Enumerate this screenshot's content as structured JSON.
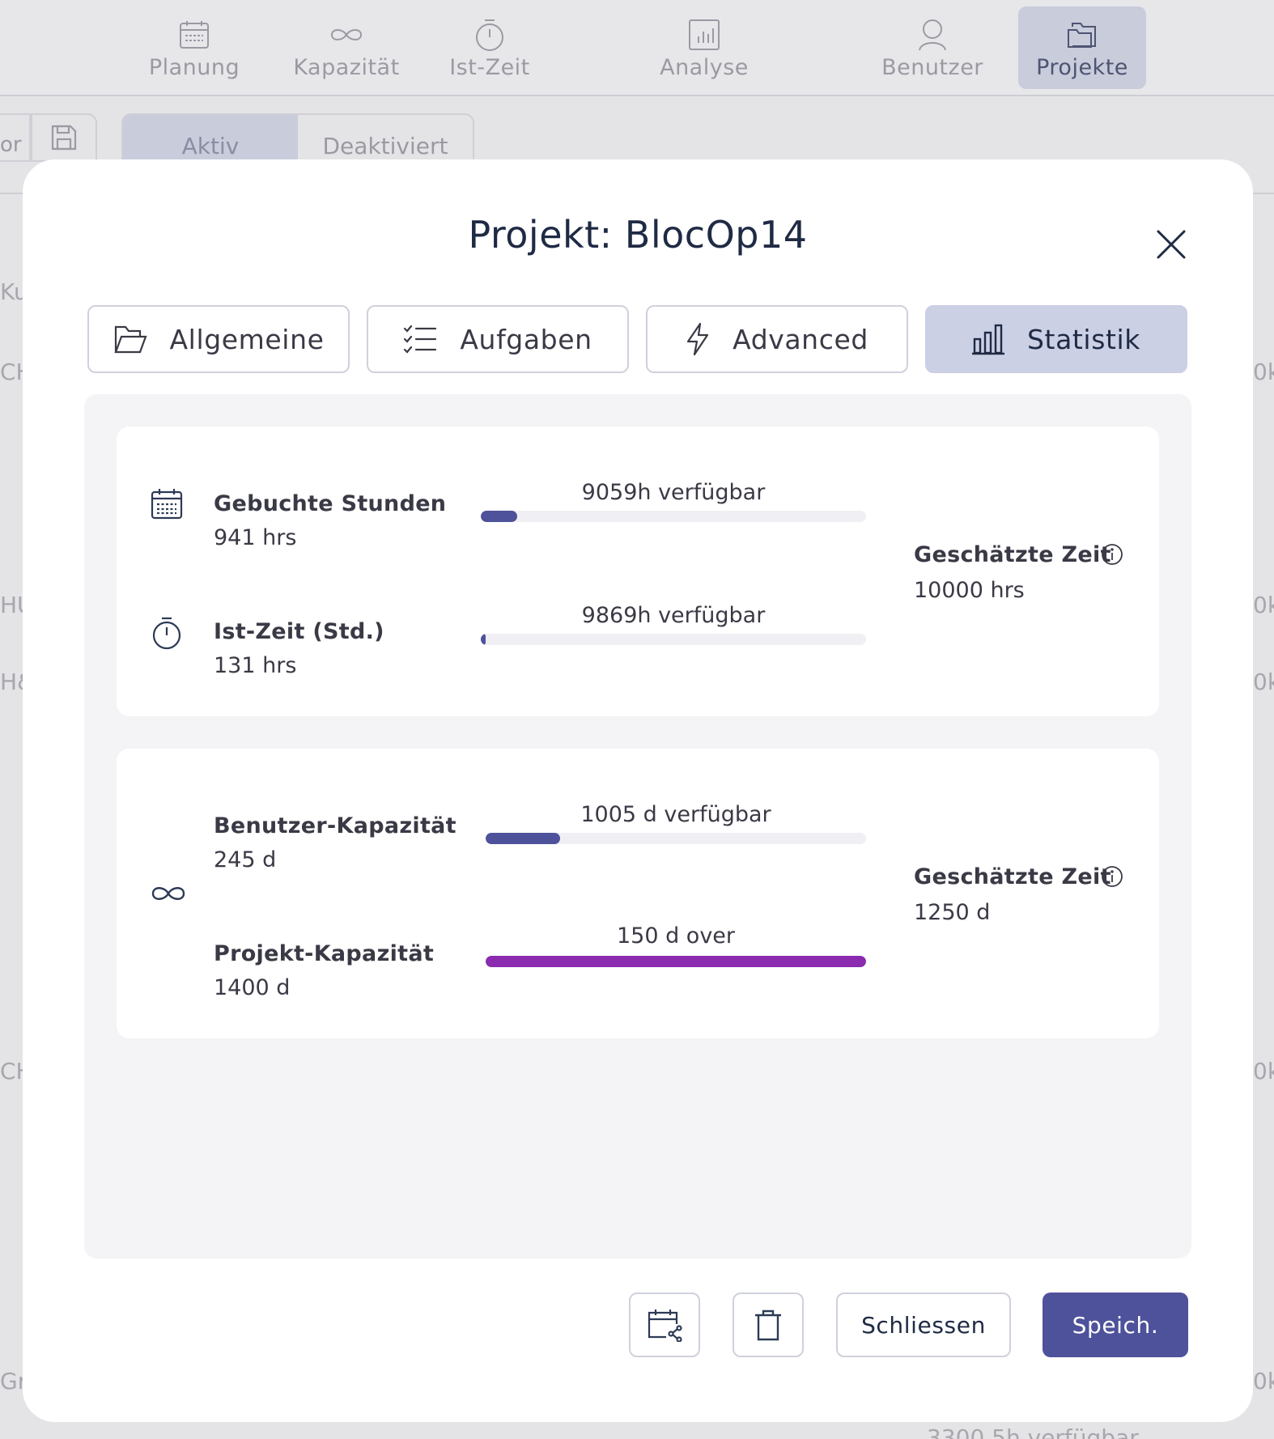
{
  "nav": {
    "items": [
      {
        "label": "Planung",
        "icon": "calendar-icon"
      },
      {
        "label": "Kapazität",
        "icon": "infinity-icon"
      },
      {
        "label": "Ist-Zeit",
        "icon": "stopwatch-icon"
      },
      {
        "label": "Analyse",
        "icon": "bar-chart-icon"
      },
      {
        "label": "Benutzer",
        "icon": "user-icon"
      },
      {
        "label": "Projekte",
        "icon": "folder-icon",
        "active": true
      }
    ]
  },
  "subbar": {
    "left_cut_text": "or",
    "tabs": [
      "Aktiv",
      "Deaktiviert"
    ]
  },
  "background_edges": {
    "left": [
      "Ku",
      "CH",
      "HU",
      "H&",
      "CH",
      "Gra"
    ],
    "right": [
      "0k",
      "0k",
      "0k",
      "0k",
      "0k"
    ],
    "bottom": "3300.5h verfügbar"
  },
  "modal": {
    "title": "Projekt: BlocOp14",
    "tabs": [
      {
        "label": "Allgemeine",
        "icon": "folder-open-icon"
      },
      {
        "label": "Aufgaben",
        "icon": "checklist-icon"
      },
      {
        "label": "Advanced",
        "icon": "lightning-icon"
      },
      {
        "label": "Statistik",
        "icon": "bar-chart-icon",
        "active": true
      }
    ],
    "hours_card": {
      "rows": [
        {
          "label": "Gebuchte Stunden",
          "value": "941 hrs",
          "caption": "9059h verfügbar",
          "fill": 0.094,
          "icon": "calendar-icon"
        },
        {
          "label": "Ist-Zeit (Std.)",
          "value": "131 hrs",
          "caption": "9869h verfügbar",
          "fill": 0.013,
          "icon": "stopwatch-icon"
        }
      ],
      "estimate_label": "Geschätzte Zeit",
      "estimate_value": "10000 hrs"
    },
    "capacity_card": {
      "rows": [
        {
          "label": "Benutzer-Kapazität",
          "value": "245 d",
          "caption": "1005 d verfügbar",
          "fill": 0.196
        },
        {
          "label": "Projekt-Kapazität",
          "value": "1400 d",
          "caption": "150 d over",
          "fill": 1.0
        }
      ],
      "icon": "infinity-icon",
      "estimate_label": "Geschätzte Zeit",
      "estimate_value": "1250 d"
    },
    "footer": {
      "close_label": "Schliessen",
      "save_label": "Speich."
    }
  },
  "colors": {
    "accent": "#4e529a",
    "bar_fill": "#4e529a",
    "over_fill": "#8a2bb0",
    "active_tab": "#cbd0e4"
  }
}
